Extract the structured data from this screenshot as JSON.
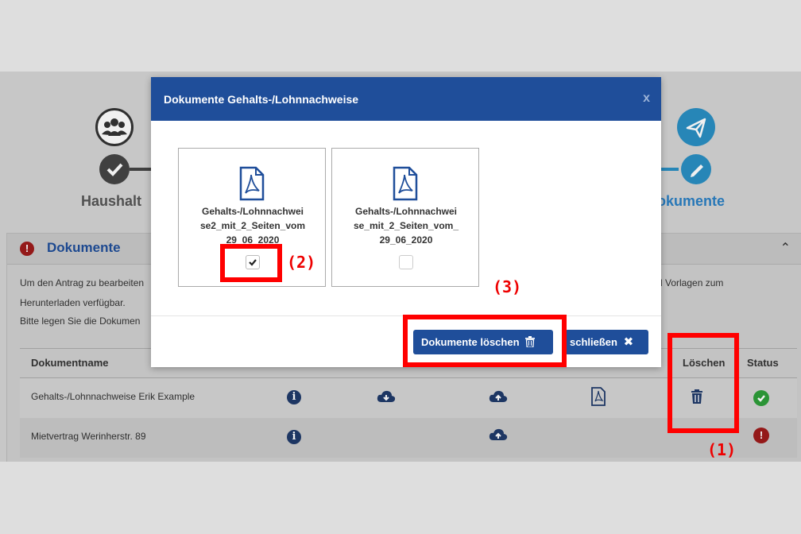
{
  "steps": [
    {
      "label": "Haushalt",
      "icon": "people-icon",
      "status": "done"
    },
    {
      "label": "Dokumente",
      "icon": "paper-plane-icon",
      "status": "active"
    }
  ],
  "panel": {
    "title": "Dokumente",
    "text_line1_left": "Um den Antrag zu bearbeiten",
    "text_line1_right": "d Vorlagen zum",
    "text_line2": "Herunterladen verfügbar.",
    "text_line3": "Bitte legen Sie die Dokumen"
  },
  "table": {
    "headers": {
      "name": "Dokumentname",
      "delete": "Löschen",
      "status": "Status"
    },
    "rows": [
      {
        "name": "Gehalts-/Lohnnachweise Erik Example",
        "status": "ok"
      },
      {
        "name": "Mietvertrag Werinherstr. 89",
        "status": "missing"
      }
    ]
  },
  "modal": {
    "title": "Dokumente Gehalts-/Lohnnachweise",
    "close": "x",
    "documents": [
      {
        "line1": "Gehalts-/Lohnnachwei",
        "line2": "se2_mit_2_Seiten_vom",
        "line3": "29_06_2020",
        "checked": true
      },
      {
        "line1": "Gehalts-/Lohnnachwei",
        "line2": "se_mit_2_Seiten_vom_",
        "line3": "29_06_2020",
        "checked": false
      }
    ],
    "delete_button": "Dokumente löschen",
    "close_button": "schließen"
  },
  "annotations": {
    "a1": "(1)",
    "a2": "(2)",
    "a3": "(3)"
  },
  "colors": {
    "modal_header": "#1f4e9a",
    "accent": "#2a8fc3",
    "highlight": "#ff0000",
    "ok": "#2e9e3a",
    "error": "#9e1b1b"
  }
}
